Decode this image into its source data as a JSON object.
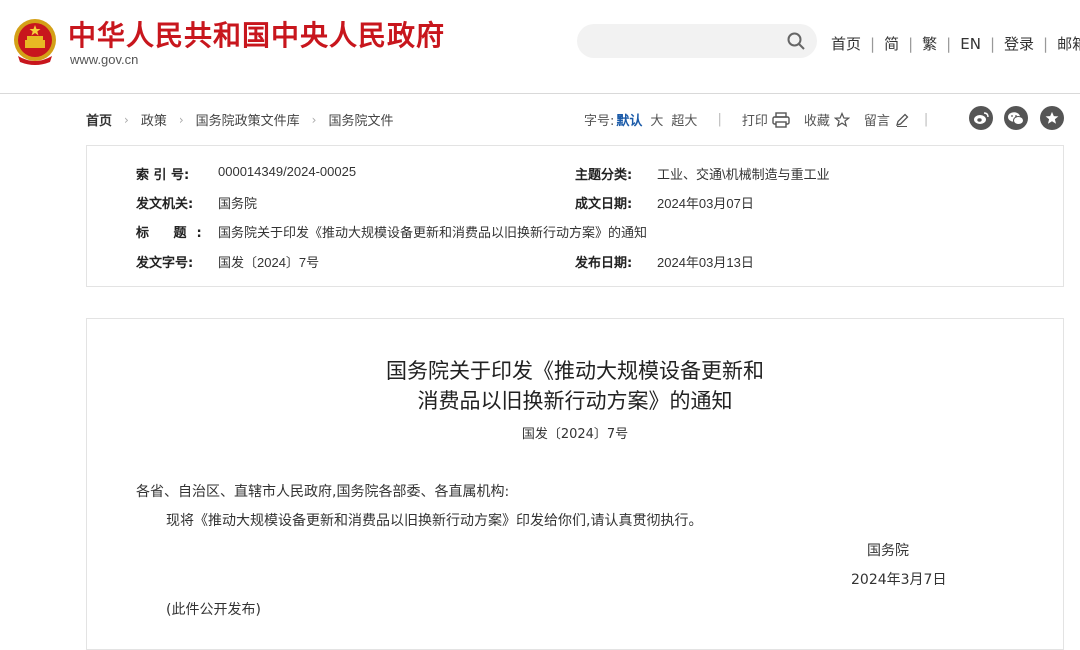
{
  "header": {
    "site_title": "中华人民共和国中央人民政府",
    "site_url": "www.gov.cn",
    "search_placeholder": "",
    "nav": [
      "首页",
      "简",
      "繁",
      "EN",
      "登录",
      "邮箱"
    ],
    "nav_separator": "|"
  },
  "breadcrumb": {
    "items": [
      "首页",
      "政策",
      "国务院政策文件库",
      "国务院文件"
    ],
    "separator": "›"
  },
  "toolbar": {
    "font_size_label": "字号:",
    "font_default": "默认",
    "font_large": "大",
    "font_xlarge": "超大",
    "print": "打印",
    "favorite": "收藏",
    "comment": "留言",
    "separator": "|"
  },
  "info": {
    "index_label": "索 引 号:",
    "index_value": "000014349/2024-00025",
    "topic_label": "主题分类:",
    "topic_value": "工业、交通\\机械制造与重工业",
    "issuer_label": "发文机关:",
    "issuer_value": "国务院",
    "date_written_label": "成文日期:",
    "date_written_value": "2024年03月07日",
    "title_label": "标 题:",
    "title_value": "国务院关于印发《推动大规模设备更新和消费品以旧换新行动方案》的通知",
    "docno_label": "发文字号:",
    "docno_value": "国发〔2024〕7号",
    "publish_label": "发布日期:",
    "publish_value": "2024年03月13日"
  },
  "article": {
    "title_line1": "国务院关于印发《推动大规模设备更新和",
    "title_line2": "消费品以旧换新行动方案》的通知",
    "doc_number": "国发〔2024〕7号",
    "salutation": "各省、自治区、直辖市人民政府,国务院各部委、各直属机构:",
    "body": "现将《推动大规模设备更新和消费品以旧换新行动方案》印发给你们,请认真贯彻执行。",
    "signer": "国务院",
    "date": "2024年3月7日",
    "note": "(此件公开发布)"
  },
  "colors": {
    "brand_red": "#c8161d",
    "active_blue": "#1a5aa8",
    "icon_gray": "#555555"
  },
  "icons": [
    "national-emblem-icon",
    "search-icon",
    "printer-icon",
    "star-icon",
    "pencil-icon",
    "weibo-icon",
    "wechat-icon",
    "star-circle-icon"
  ]
}
